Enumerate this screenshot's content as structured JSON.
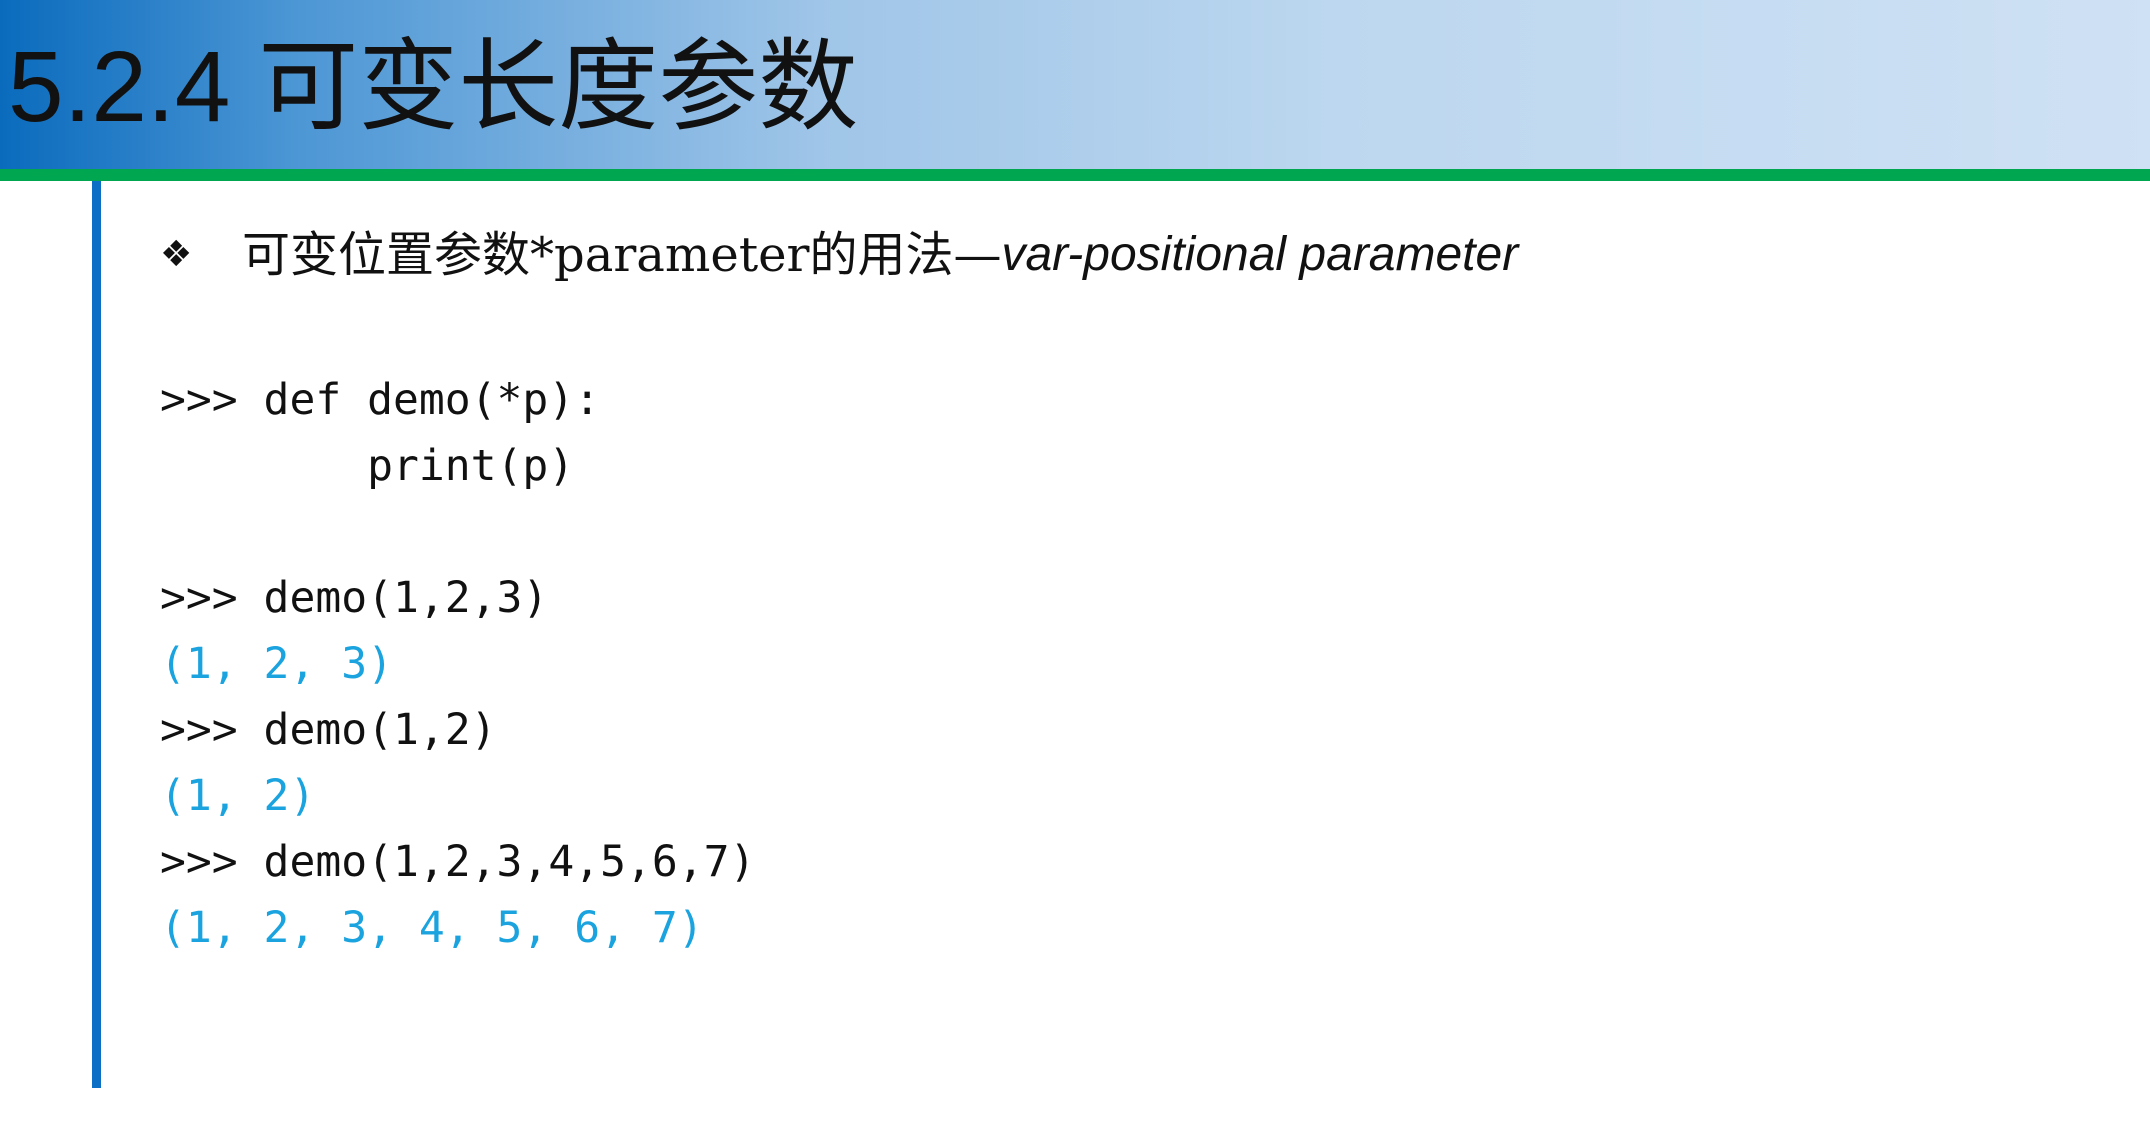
{
  "slide": {
    "title": "5.2.4  可变长度参数",
    "bullet": {
      "text_cn": "可变位置参数*parameter的用法—",
      "text_en": "var-positional parameter"
    },
    "code_lines": [
      {
        "text": ">>> def demo(*p):",
        "kind": "input"
      },
      {
        "text": "        print(p)",
        "kind": "input"
      },
      {
        "text": ">>> demo(1,2,3)",
        "kind": "input"
      },
      {
        "text": "(1, 2, 3)",
        "kind": "output"
      },
      {
        "text": ">>> demo(1,2)",
        "kind": "input"
      },
      {
        "text": "(1, 2)",
        "kind": "output"
      },
      {
        "text": ">>> demo(1,2,3,4,5,6,7)",
        "kind": "input"
      },
      {
        "text": "(1, 2, 3, 4, 5, 6, 7)",
        "kind": "output"
      }
    ],
    "colors": {
      "title_gradient_start": "#0a6bbd",
      "title_gradient_end": "#cfe1f4",
      "accent_rule": "#00a650",
      "side_bar": "#0b6fc5",
      "output_text": "#1aa3de"
    },
    "icons": {
      "bullet": "diamond-bullet-icon"
    }
  }
}
